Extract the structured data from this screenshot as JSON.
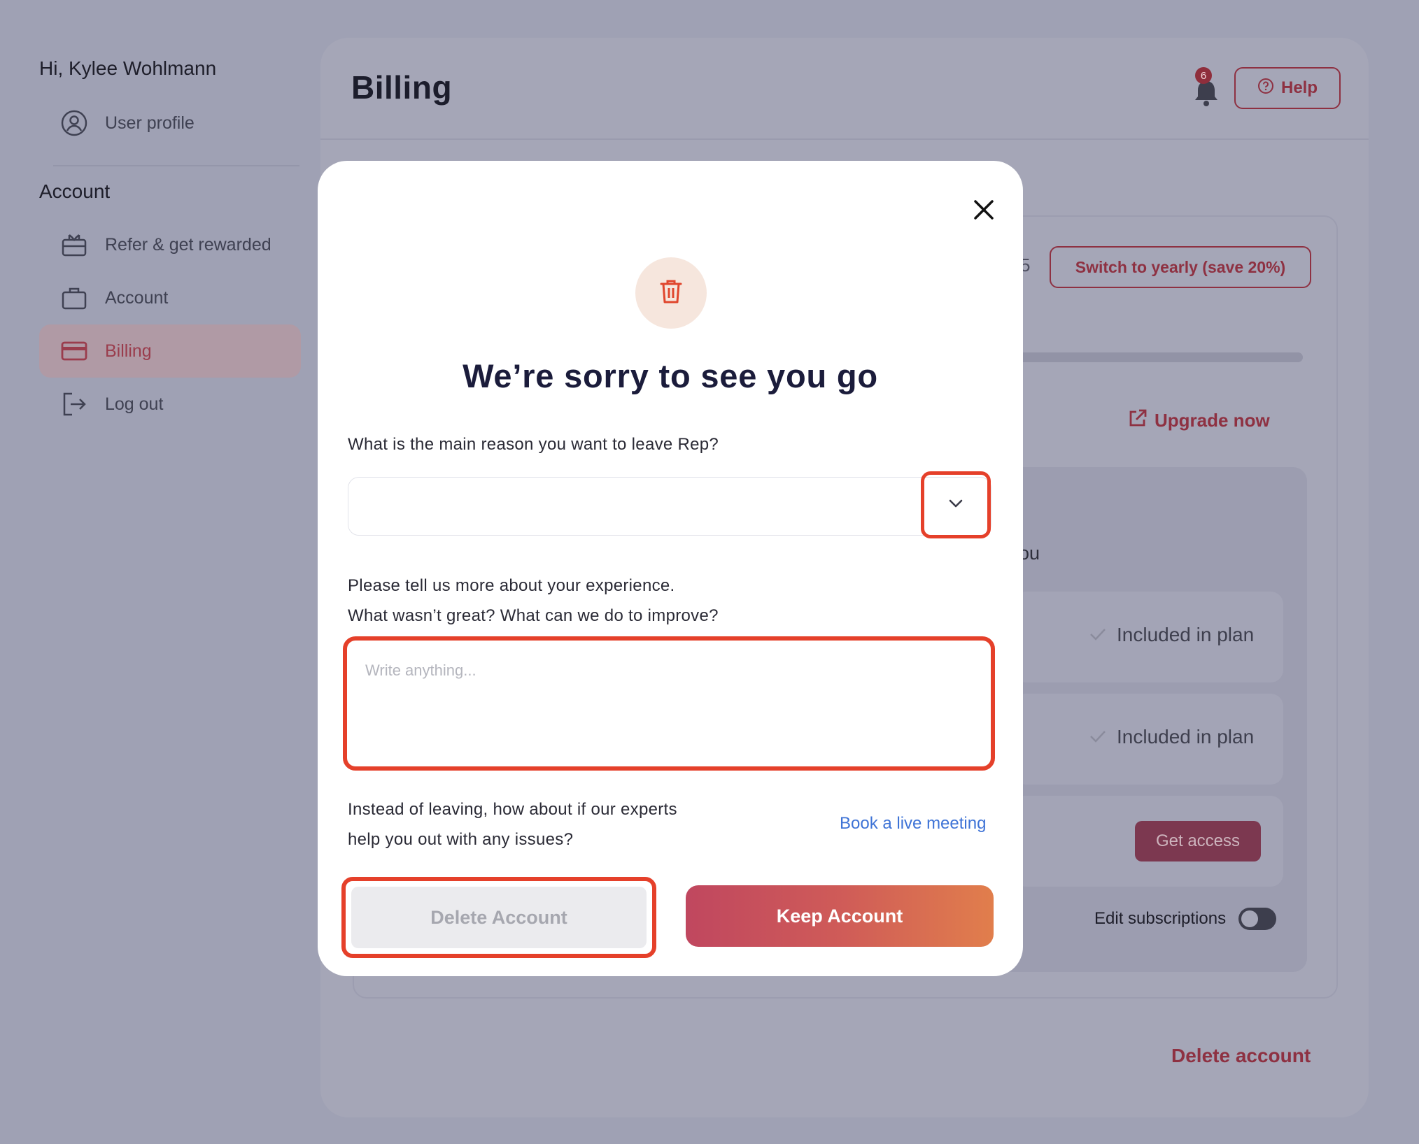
{
  "sidebar": {
    "greeting": "Hi, Kylee Wohlmann",
    "items": [
      {
        "label": "User profile",
        "icon": "user-circle-icon"
      },
      {
        "label": "Refer & get rewarded",
        "icon": "gift-icon"
      },
      {
        "label": "Account",
        "icon": "briefcase-icon"
      },
      {
        "label": "Billing",
        "icon": "credit-card-icon",
        "active": true
      },
      {
        "label": "Log out",
        "icon": "logout-icon"
      }
    ],
    "section_title": "Account"
  },
  "main": {
    "title": "Billing",
    "notification_count": "6",
    "help_label": "Help",
    "switch_label": "Switch to yearly (save 20%)",
    "partial_price_digit": "5",
    "upgrade_label": "Upgrade now",
    "partial_you": "ou",
    "features": [
      {
        "status": "Included in plan"
      },
      {
        "status": "Included in plan"
      }
    ],
    "get_access_label": "Get access",
    "edit_subscriptions_label": "Edit subscriptions",
    "delete_account_link": "Delete account"
  },
  "modal": {
    "title": "We’re sorry to see you go",
    "reason_question": "What is the main reason you want to leave Rep?",
    "reason_value": "",
    "feedback_line1": "Please tell us more about your experience.",
    "feedback_line2": "What wasn’t great? What can we do to improve?",
    "feedback_placeholder": "Write anything...",
    "suggest_line1": "Instead of leaving, how about if our experts",
    "suggest_line2": "help you out with any issues?",
    "book_meeting_label": "Book a live meeting",
    "delete_button": "Delete Account",
    "keep_button": "Keep Account"
  },
  "colors": {
    "accent": "#8e3142",
    "highlight_outline": "#e5402a",
    "link": "#3e73d6",
    "title_navy": "#1b1c3b"
  }
}
